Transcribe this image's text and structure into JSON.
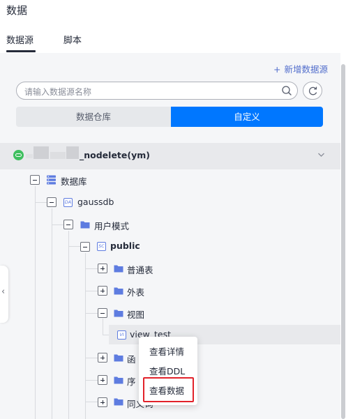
{
  "header": {
    "title": "数据",
    "tabs": [
      {
        "label": "数据源",
        "active": true
      },
      {
        "label": "脚本",
        "active": false
      }
    ]
  },
  "toolbar": {
    "new_datasource": "新增数据源",
    "search_placeholder": "请输入数据源名称"
  },
  "segments": {
    "warehouse": "数据仓库",
    "custom": "自定义",
    "active": "custom"
  },
  "tree": {
    "connection_label": "_nodelete(ym)",
    "database_group": "数据库",
    "database": "gaussdb",
    "schema_group": "用户模式",
    "schema": "public",
    "folders": {
      "normal_tables": "普通表",
      "foreign_tables": "外表",
      "views": "视图",
      "functions": "函",
      "sequences": "序",
      "synonyms": "同义词"
    },
    "view_item": "view_test",
    "badges": {
      "database": "DA",
      "schema": "SC",
      "view": "VI"
    }
  },
  "context_menu": {
    "items": [
      "查看详情",
      "查看DDL",
      "查看数据"
    ],
    "highlighted": "查看数据"
  },
  "colors": {
    "primary": "#0077ff",
    "link": "#526ecc",
    "folder": "#5e7ce0",
    "highlight_border": "#e2222a",
    "connection_status": "#3fbf5f"
  }
}
